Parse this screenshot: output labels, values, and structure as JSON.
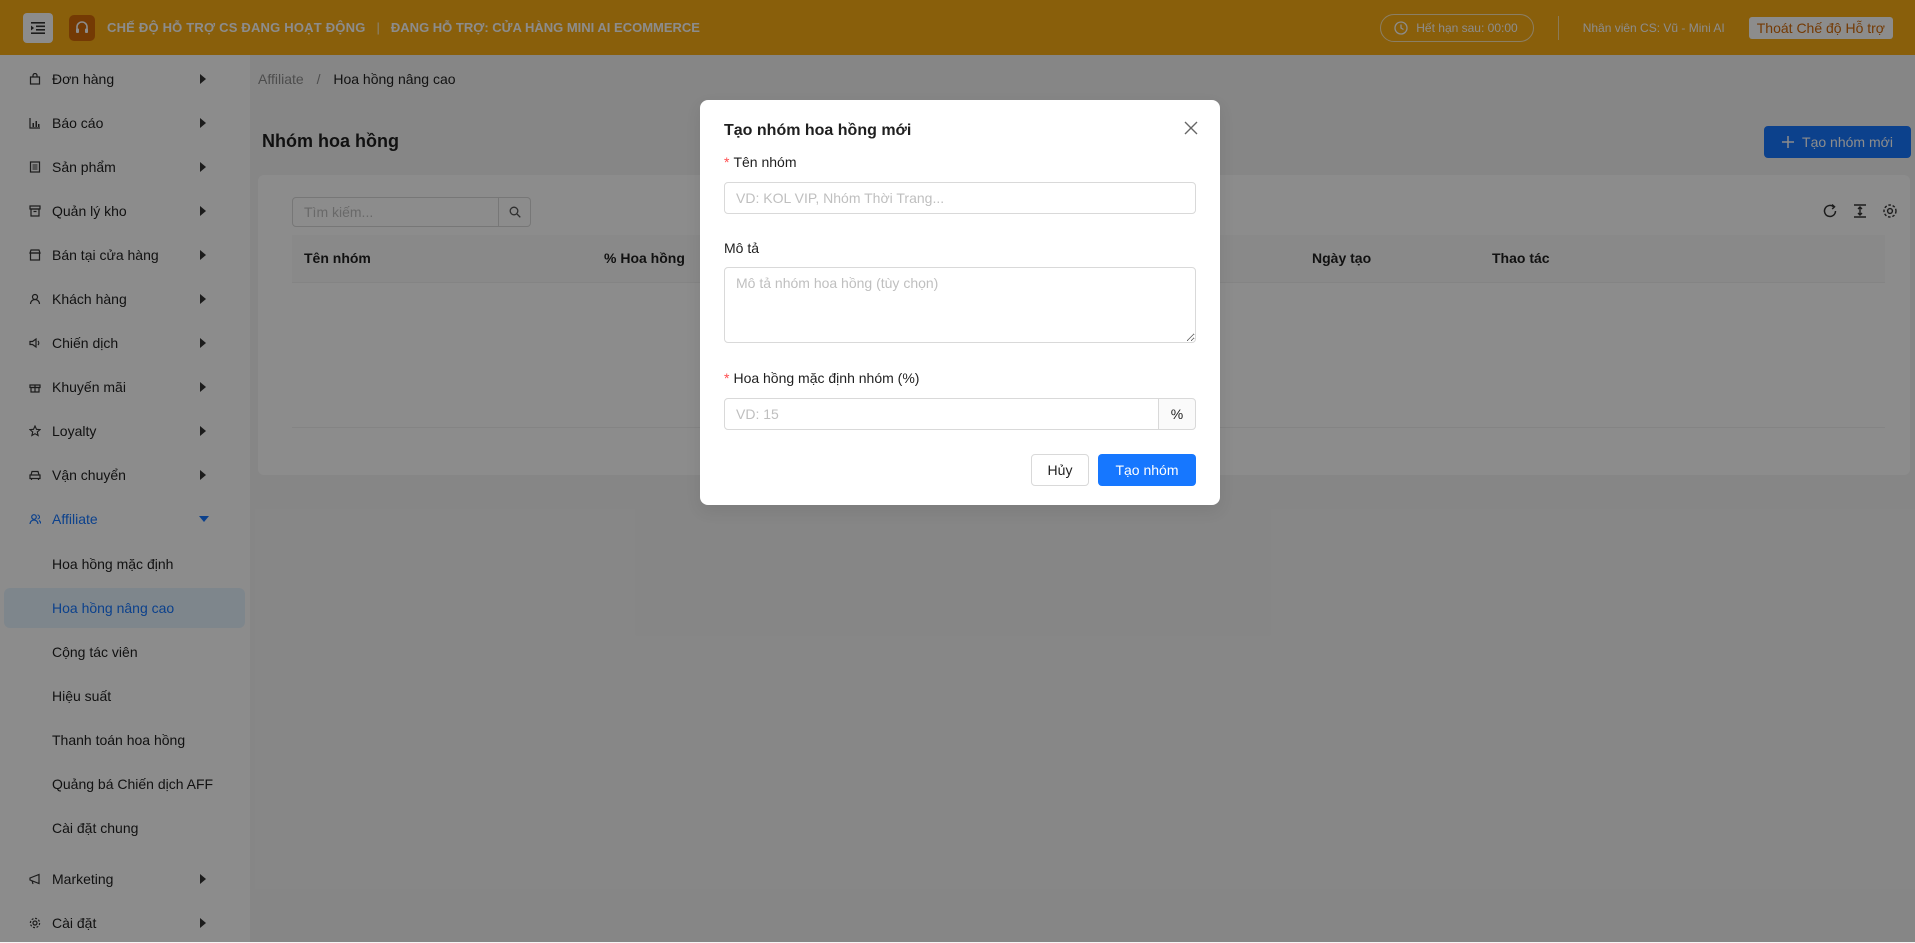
{
  "topbar": {
    "mode_text": "CHẾ ĐỘ HỖ TRỢ CS ĐANG HOẠT ĐỘNG",
    "separator": "|",
    "support_text": "ĐANG HỖ TRỢ: CỬA HÀNG MINI AI ECOMMERCE",
    "timer": "Hết hạn sau: 00:00",
    "staff": "Nhân viên CS: Vũ - Mini AI",
    "exit_label": "Thoát Chế độ Hỗ trợ"
  },
  "sidebar": {
    "items": [
      {
        "label": "Đơn hàng",
        "icon": "bag-icon"
      },
      {
        "label": "Báo cáo",
        "icon": "bar-chart-icon"
      },
      {
        "label": "Sản phẩm",
        "icon": "list-icon"
      },
      {
        "label": "Quản lý kho",
        "icon": "warehouse-icon"
      },
      {
        "label": "Bán tại cửa hàng",
        "icon": "shop-icon"
      },
      {
        "label": "Khách hàng",
        "icon": "user-icon"
      },
      {
        "label": "Chiến dịch",
        "icon": "sound-icon"
      },
      {
        "label": "Khuyến mãi",
        "icon": "gift-icon"
      },
      {
        "label": "Loyalty",
        "icon": "star-icon"
      },
      {
        "label": "Vận chuyển",
        "icon": "car-icon"
      },
      {
        "label": "Affiliate",
        "icon": "team-icon"
      }
    ],
    "affiliate_sub": [
      "Hoa hồng mặc định",
      "Hoa hồng nâng cao",
      "Cộng tác viên",
      "Hiệu suất",
      "Thanh toán hoa hồng",
      "Quảng bá Chiến dịch AFF",
      "Cài đặt chung"
    ],
    "bottom": [
      {
        "label": "Marketing",
        "icon": "megaphone-icon"
      },
      {
        "label": "Cài đặt",
        "icon": "gear-icon"
      }
    ]
  },
  "breadcrumb": {
    "parent": "Affiliate",
    "sep": "/",
    "current": "Hoa hồng nâng cao"
  },
  "page": {
    "title": "Nhóm hoa hồng",
    "add_button": "Tạo nhóm mới",
    "search_placeholder": "Tìm kiếm...",
    "columns": [
      "Tên nhóm",
      "% Hoa hồng",
      "Ngày tạo",
      "Thao tác"
    ]
  },
  "modal": {
    "title": "Tạo nhóm hoa hồng mới",
    "required_mark": "*",
    "name_label": "Tên nhóm",
    "name_placeholder": "VD: KOL VIP, Nhóm Thời Trang...",
    "desc_label": "Mô tả",
    "desc_placeholder": "Mô tả nhóm hoa hồng (tùy chọn)",
    "rate_label": "Hoa hồng mặc định nhóm (%)",
    "rate_placeholder": "VD: 15",
    "rate_suffix": "%",
    "cancel": "Hủy",
    "submit": "Tạo nhóm"
  },
  "colors": {
    "topbar": "#faad14",
    "primary": "#1677ff",
    "required": "#ff4d4f"
  }
}
